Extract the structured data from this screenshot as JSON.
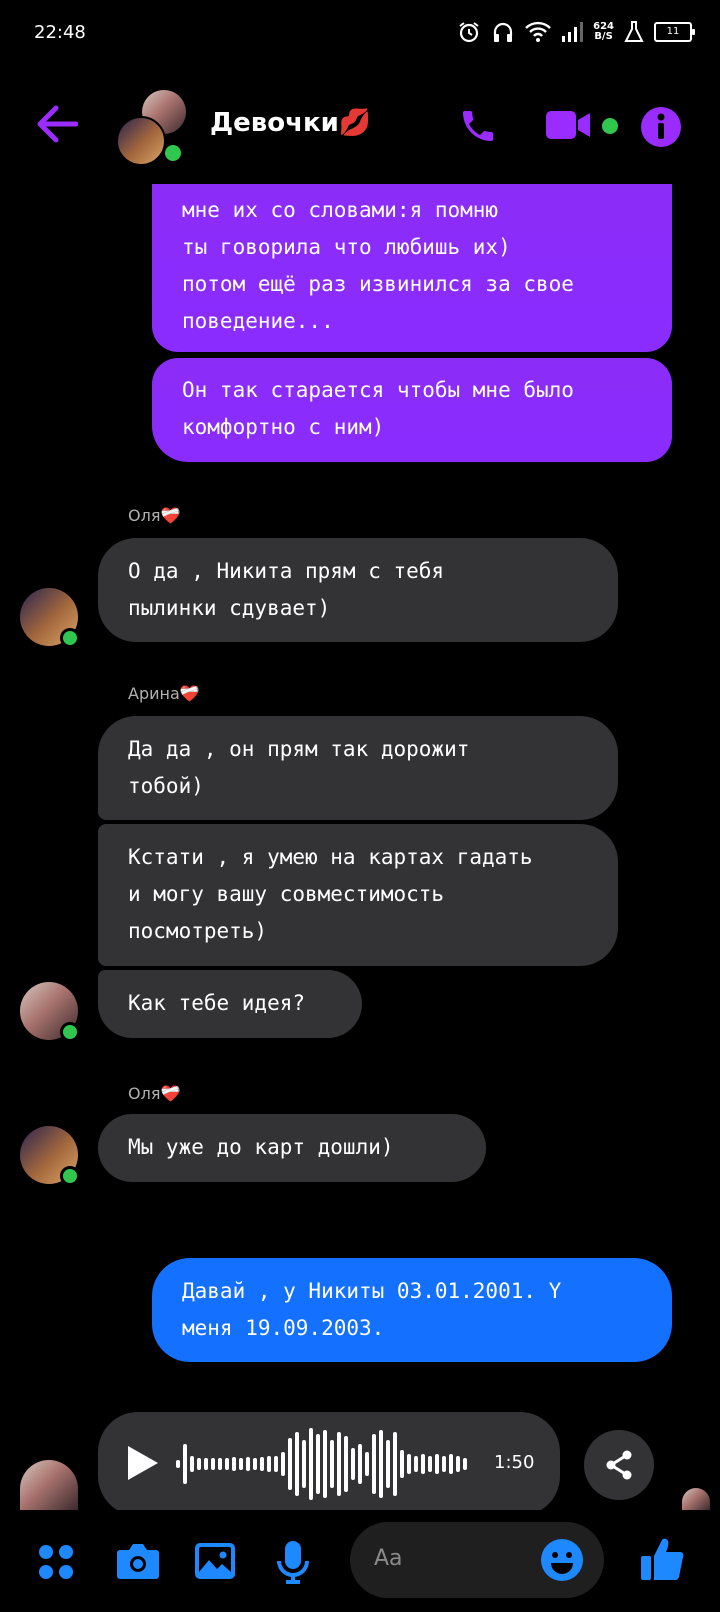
{
  "status": {
    "time": "22:48",
    "speed_value": "624",
    "speed_unit": "B/S",
    "battery": "11"
  },
  "header": {
    "title": "Девочки💋"
  },
  "messages": {
    "out1_lines": [
      "мне их со словами:я помню",
      "ты говорила что любишь их)",
      "потом ещё раз извинился за свое",
      "поведение..."
    ],
    "out2_lines": [
      "Он так старается чтобы мне было",
      "комфортно с ним)"
    ],
    "sender1": "Оля❤️‍🩹",
    "in1_lines": [
      "О да , Никита прям с тебя",
      "пылинки сдувает)"
    ],
    "sender2": "Арина❤️‍🩹",
    "in2_lines": [
      "Да да , он прям так дорожит",
      "тобой)"
    ],
    "in3_lines": [
      "Кстати , я умею на картах гадать",
      "и могу вашу совместимость",
      "посмотреть)"
    ],
    "in4": "Как тебе идея?",
    "sender3": "Оля❤️‍🩹",
    "in5": "Мы уже до карт дошли)",
    "out3_lines": [
      "Давай , у Никиты 03.01.2001. Y",
      "меня 19.09.2003."
    ],
    "voice_duration": "1:50"
  },
  "composer": {
    "placeholder": "Aa"
  },
  "colors": {
    "accent": "#8a2cff",
    "blue": "#1470ff",
    "incoming": "#333336",
    "online": "#31c74f"
  },
  "icons": [
    "back-arrow-icon",
    "phone-icon",
    "video-icon",
    "info-icon",
    "apps-icon",
    "camera-icon",
    "image-icon",
    "mic-icon",
    "emoji-icon",
    "like-icon",
    "share-icon",
    "play-icon"
  ]
}
